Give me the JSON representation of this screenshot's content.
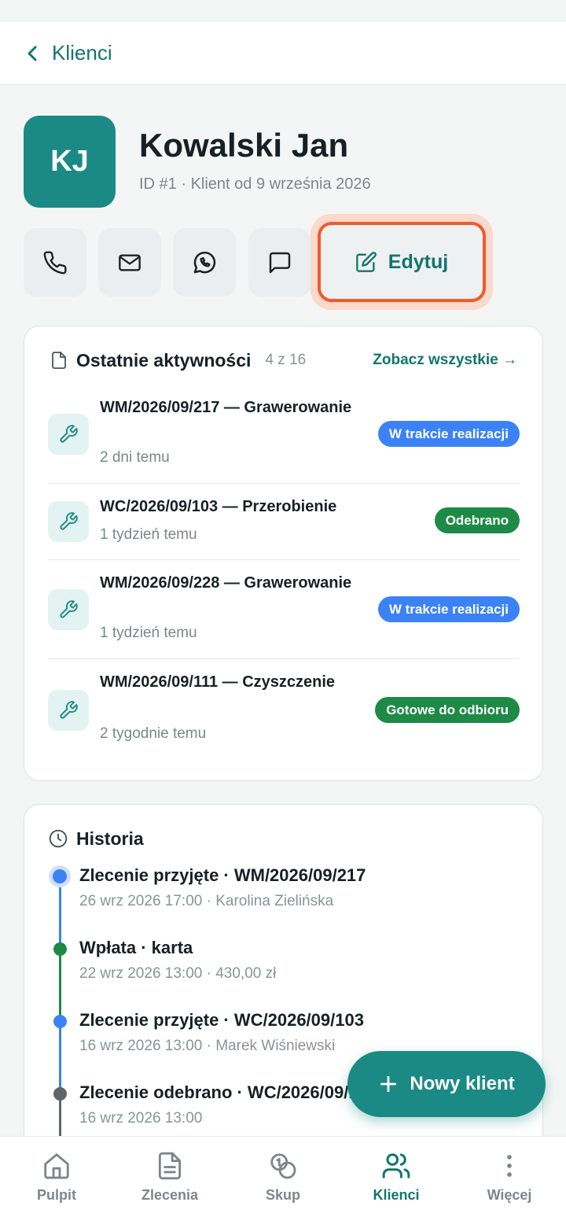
{
  "header": {
    "back_label": "Klienci"
  },
  "client": {
    "initials": "KJ",
    "name": "Kowalski Jan",
    "meta": "ID #1 · Klient od 9 września 2026"
  },
  "actions": {
    "edit_label": "Edytuj"
  },
  "activities": {
    "title": "Ostatnie aktywności",
    "count": "4 z 16",
    "see_all": "Zobacz wszystkie →",
    "items": [
      {
        "title": "WM/2026/09/217 — Grawerowanie",
        "time": "2 dni temu",
        "status": "W trakcie realizacji",
        "status_color": "#3b82f6"
      },
      {
        "title": "WC/2026/09/103 — Przerobienie",
        "time": "1 tydzień temu",
        "status": "Odebrano",
        "status_color": "#1d8a46"
      },
      {
        "title": "WM/2026/09/228 — Grawerowanie",
        "time": "1 tydzień temu",
        "status": "W trakcie realizacji",
        "status_color": "#3b82f6"
      },
      {
        "title": "WM/2026/09/111 — Czyszczenie",
        "time": "2 tygodnie temu",
        "status": "Gotowe do odbioru",
        "status_color": "#1d8a46"
      }
    ]
  },
  "history": {
    "title": "Historia",
    "items": [
      {
        "title": "Zlecenie przyjęte · WM/2026/09/217",
        "sub": "26 wrz 2026 17:00 · Karolina Zielińska",
        "color": "#3b82f6"
      },
      {
        "title": "Wpłata · karta",
        "sub": "22 wrz 2026 13:00 · 430,00 zł",
        "color": "#1d8a46"
      },
      {
        "title": "Zlecenie przyjęte · WC/2026/09/103",
        "sub": "16 wrz 2026 13:00 · Marek Wiśniewski",
        "color": "#3b82f6"
      },
      {
        "title": "Zlecenie odebrano · WC/2026/09/103",
        "sub": "16 wrz 2026 13:00",
        "color": "#5f6568"
      }
    ]
  },
  "fab": {
    "label": "Nowy klient"
  },
  "nav": {
    "items": [
      {
        "label": "Pulpit",
        "icon": "home-icon"
      },
      {
        "label": "Zlecenia",
        "icon": "document-icon"
      },
      {
        "label": "Skup",
        "icon": "coins-icon"
      },
      {
        "label": "Klienci",
        "icon": "users-icon",
        "active": true
      },
      {
        "label": "Więcej",
        "icon": "more-vertical-icon"
      }
    ]
  }
}
